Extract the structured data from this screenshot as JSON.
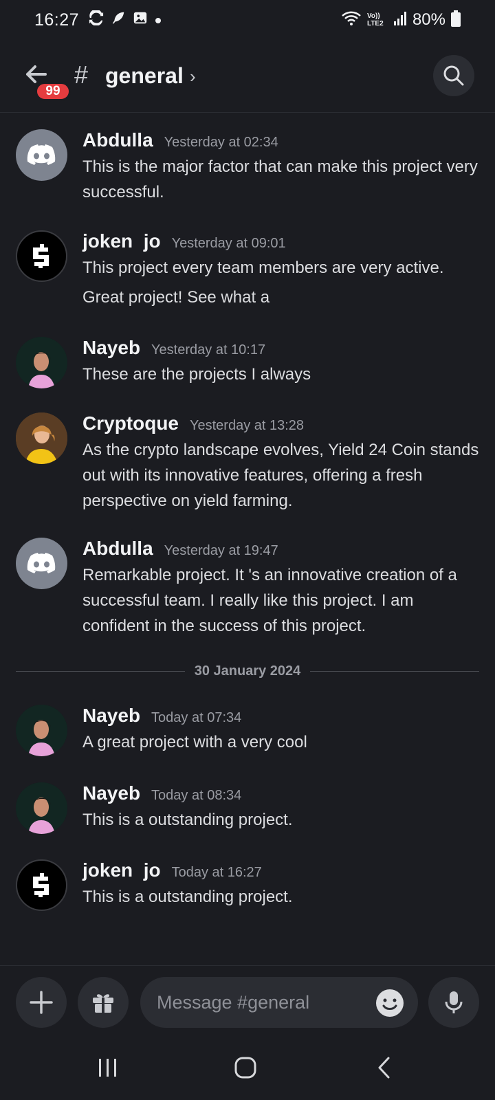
{
  "status_bar": {
    "time": "16:27",
    "network": "Vo)) LTE2",
    "battery": "80%"
  },
  "header": {
    "unread_count": "99",
    "hash": "#",
    "channel_name": "general",
    "chevron": "›"
  },
  "messages": [
    {
      "author": "Abdulla",
      "timestamp": "Yesterday at 02:34",
      "avatar": "discord-logo-avatar",
      "lines": [
        "This is the major factor that can make this project very successful."
      ]
    },
    {
      "author": "joken  jo",
      "timestamp": "Yesterday at 09:01",
      "avatar": "s-logo-avatar",
      "lines": [
        "This project every team members are very active.",
        "Great project! See what a"
      ]
    },
    {
      "author": "Nayeb",
      "timestamp": "Yesterday at 10:17",
      "avatar": "photo-avatar",
      "lines": [
        "These are the projects I always"
      ]
    },
    {
      "author": "Cryptoque",
      "timestamp": "Yesterday at 13:28",
      "avatar": "photo-avatar",
      "lines": [
        "As the crypto landscape evolves, Yield 24 Coin stands out with its innovative features, offering a fresh perspective on yield farming."
      ]
    },
    {
      "author": "Abdulla",
      "timestamp": "Yesterday at 19:47",
      "avatar": "discord-logo-avatar",
      "lines": [
        "Remarkable project. It 's an innovative creation of a successful team. I really like this project. I am confident in the success of this project."
      ]
    },
    {
      "author": "Nayeb",
      "timestamp": "Today at 07:34",
      "avatar": "photo-avatar",
      "lines": [
        "A great project with a very cool"
      ]
    },
    {
      "author": "Nayeb",
      "timestamp": "Today at 08:34",
      "avatar": "photo-avatar",
      "lines": [
        "This is a outstanding project."
      ]
    },
    {
      "author": "joken  jo",
      "timestamp": "Today at 16:27",
      "avatar": "s-logo-avatar",
      "lines": [
        "This is a outstanding project."
      ]
    }
  ],
  "date_divider": "30 January 2024",
  "composer": {
    "placeholder": "Message #general"
  },
  "colors": {
    "background": "#1b1c21",
    "surface": "#2b2d33",
    "badge": "#e53c3f",
    "discord_avatar": "#7e8490"
  }
}
